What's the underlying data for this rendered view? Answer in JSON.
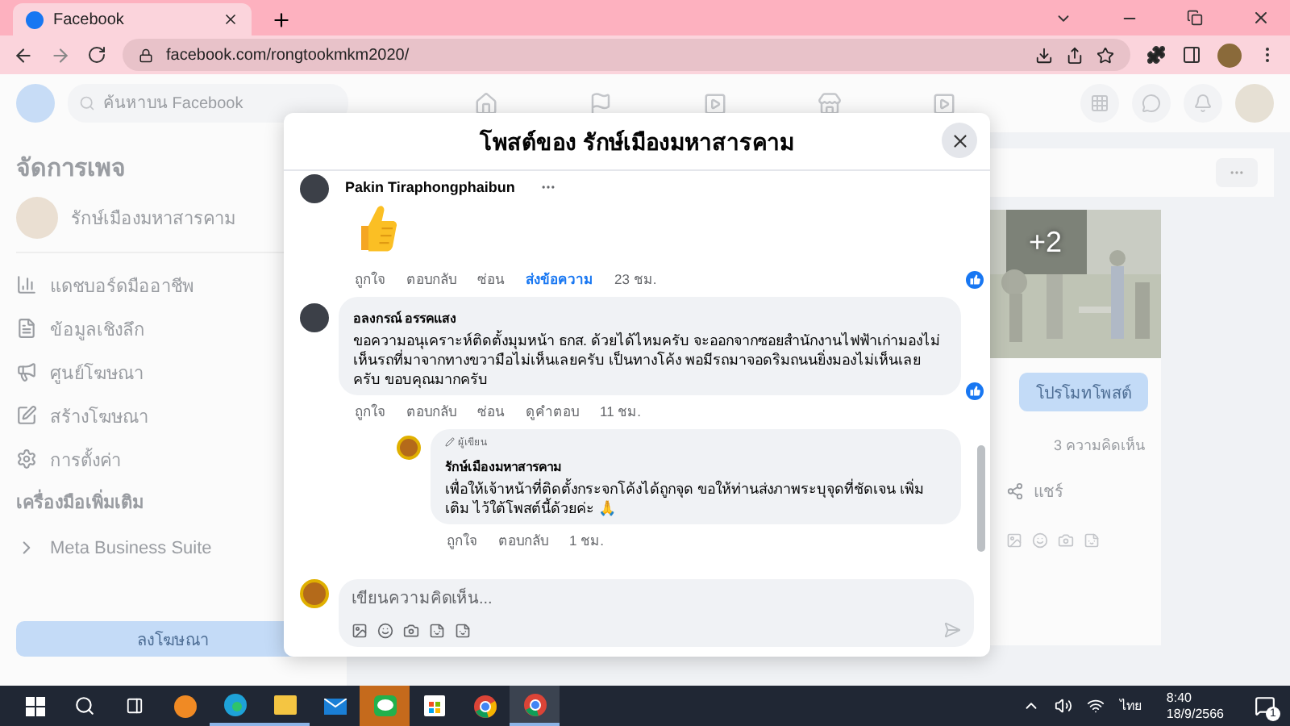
{
  "browser": {
    "tab_title": "Facebook",
    "url": "facebook.com/rongtookmkm2020/"
  },
  "fb_nav": {
    "search": {
      "placeholder": "ค้นหาบน Facebook"
    }
  },
  "sidebar": {
    "title": "จัดการเพจ",
    "page_name": "รักษ์เมืองมหาสารคาม",
    "items": [
      {
        "label": "แดชบอร์ดมืออาชีพ",
        "kind": "dashboard"
      },
      {
        "label": "ข้อมูลเชิงลึก",
        "kind": "insights"
      },
      {
        "label": "ศูนย์โฆษณา",
        "kind": "ads"
      },
      {
        "label": "สร้างโฆษณา",
        "kind": "create"
      },
      {
        "label": "การตั้งค่า",
        "kind": "settings"
      }
    ],
    "section_title": "เครื่องมือเพิ่มเติม",
    "tools": [
      {
        "label": "Meta Business Suite"
      }
    ],
    "button": "ลงโฆษณา"
  },
  "post": {
    "photo_more": "+2",
    "promote_button": "โปรโมทโพสต์",
    "comments_count": "3 ความคิดเห็น",
    "share": "แชร์"
  },
  "modal": {
    "title": "โพสต์ของ รักษ์เมืองมหาสารคาม",
    "comments": [
      {
        "author": "Pakin Tiraphongphaibun",
        "kind": "sticker",
        "reacted": true,
        "time": "23 ชม.",
        "actions": [
          {
            "label": "ถูกใจ",
            "emphasized": false
          },
          {
            "label": "ตอบกลับ",
            "emphasized": false
          },
          {
            "label": "ซ่อน",
            "emphasized": false
          },
          {
            "label": "ส่งข้อความ",
            "emphasized": true
          }
        ]
      },
      {
        "author": "อลงกรณ์ อรรคแสง",
        "kind": "text",
        "reacted": true,
        "time": "11 ชม.",
        "text": "ขอความอนุเคราะห์ติดตั้งมุมหน้า ธกส. ด้วยได้ไหมครับ จะออกจากซอยสำนักงานไฟฟ้าเก่ามองไม่เห็นรถที่มาจากทางขวามือไม่เห็นเลยครับ เป็นทางโค้ง พอมีรถมาจอดริมถนนยิ่งมองไม่เห็นเลยครับ ขอบคุณมากครับ",
        "actions": [
          {
            "label": "ถูกใจ",
            "emphasized": false
          },
          {
            "label": "ตอบกลับ",
            "emphasized": false
          },
          {
            "label": "ซ่อน",
            "emphasized": false
          },
          {
            "label": "ดูคำตอบ",
            "emphasized": false
          }
        ],
        "replies": [
          {
            "author": "รักษ์เมืองมหาสารคาม",
            "badge": "ผู้เขียน",
            "kind": "text",
            "time": "1 ชม.",
            "text": "เพื่อให้เจ้าหน้าที่ติดตั้งกระจกโค้งได้ถูกจุด ขอให้ท่านส่งภาพระบุจุดที่ชัดเจน เพิ่มเติม ไว้ใต้โพสต์นี้ด้วยค่ะ 🙏",
            "actions": [
              {
                "label": "ถูกใจ",
                "emphasized": false
              },
              {
                "label": "ตอบกลับ",
                "emphasized": false
              }
            ]
          }
        ]
      }
    ],
    "composer": {
      "placeholder": "เขียนความคิดเห็น..."
    }
  },
  "taskbar": {
    "language": "ไทย",
    "time": "8:40",
    "date": "18/9/2566",
    "notifications": "1"
  }
}
